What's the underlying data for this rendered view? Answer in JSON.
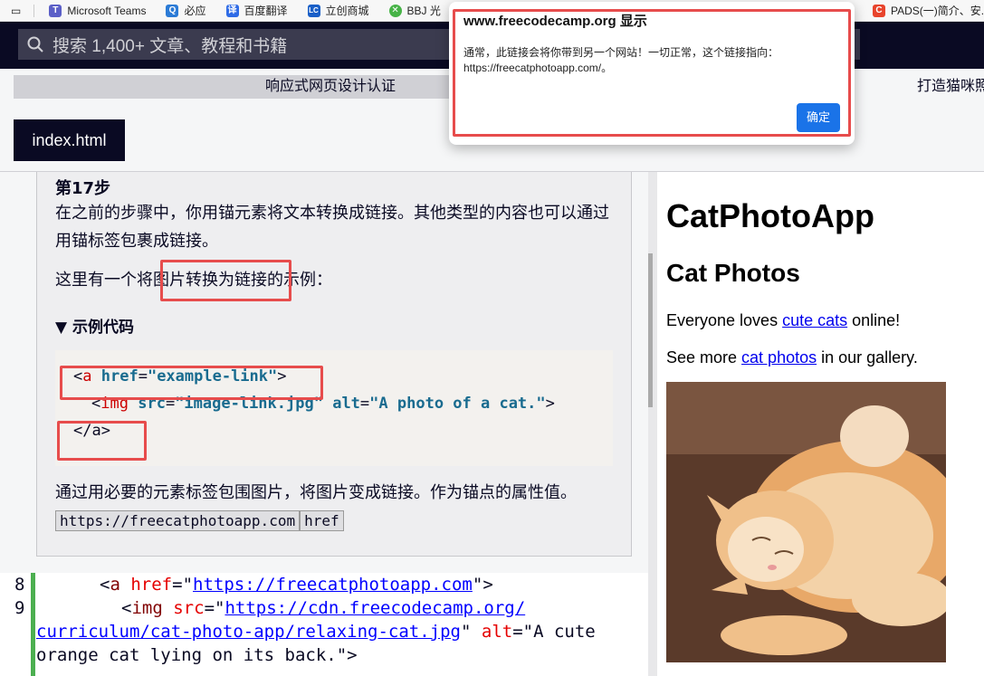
{
  "bookmarks": [
    {
      "label": "Microsoft Teams",
      "color": "#5b5fc7",
      "glyph": "T"
    },
    {
      "label": "必应",
      "color": "#2b7bd6",
      "glyph": "Q"
    },
    {
      "label": "百度翻译",
      "color": "#2e6be6",
      "glyph": "译"
    },
    {
      "label": "立创商城",
      "color": "#1a5fc7",
      "glyph": "LC"
    },
    {
      "label": "BBJ 光",
      "color": "#47b347",
      "glyph": "✕"
    }
  ],
  "bookmark_right": {
    "label": "PADS(一)简介、安...",
    "color": "#e8442c",
    "glyph": "C"
  },
  "search": {
    "placeholder": "搜索 1,400+ 文章、教程和书籍"
  },
  "breadcrumbs": {
    "course": "响应式网页设计认证",
    "project": "打造猫咪照"
  },
  "editor_tab": "index.html",
  "description": {
    "step": "第17步",
    "para1": "在之前的步骤中，你用锚元素将文本转换成链接。其他类型的内容也可以通过用锚标签包裹成链接。",
    "para2_before": "这里有一个将",
    "para2_highlight": "图片转换为链接",
    "para2_after": "的示例：",
    "summary": "▼ 示例代码",
    "code": {
      "l1_open": "<",
      "l1_tag": "a",
      "l1_attr": "href",
      "l1_eq": "=",
      "l1_val": "\"example-link\"",
      "l1_close": ">",
      "l2_open": "<",
      "l2_tag": "img",
      "l2_attr1": "src",
      "l2_val1": "\"image-link.jpg\"",
      "l2_attr2": "alt",
      "l2_val2": "\"A photo of a cat.\"",
      "l2_close": ">",
      "l3": "</a>"
    },
    "para3": "通过用必要的元素标签包围图片，将图片变成链接。作为锚点的属性值。",
    "inline_code1": "https://freecatphotoapp.com",
    "inline_code2": "href"
  },
  "editor": {
    "lines": [
      {
        "num": "8"
      },
      {
        "num": "9"
      }
    ],
    "line8_tag": "a",
    "line8_attr": "href",
    "line8_url": "https://freecatphotoapp.com",
    "line9_tag": "img",
    "line9_attr": "src",
    "line9_url_a": "https://cdn.freecodecamp.org/",
    "line9_url_b": "curriculum/cat-photo-app/relaxing-cat.jpg",
    "line9_alt": "alt",
    "line9_altval_a": "\"A cute",
    "line9_altval_b": "orange cat lying on its back.\""
  },
  "preview": {
    "h1": "CatPhotoApp",
    "h2": "Cat Photos",
    "p1_before": "Everyone loves ",
    "p1_link": "cute cats",
    "p1_after": " online!",
    "p2_before": "See more ",
    "p2_link": "cat photos",
    "p2_after": " in our gallery."
  },
  "dialog": {
    "title": "www.freecodecamp.org 显示",
    "message": "通常，此链接会将你带到另一个网站！一切正常，这个链接指向：https://freecatphotoapp.com/。",
    "ok_label": "确定"
  },
  "colors": {
    "nav_dark": "#0a0a23",
    "accent_blue": "#1a73e8",
    "highlight_red": "#e74c4c"
  }
}
